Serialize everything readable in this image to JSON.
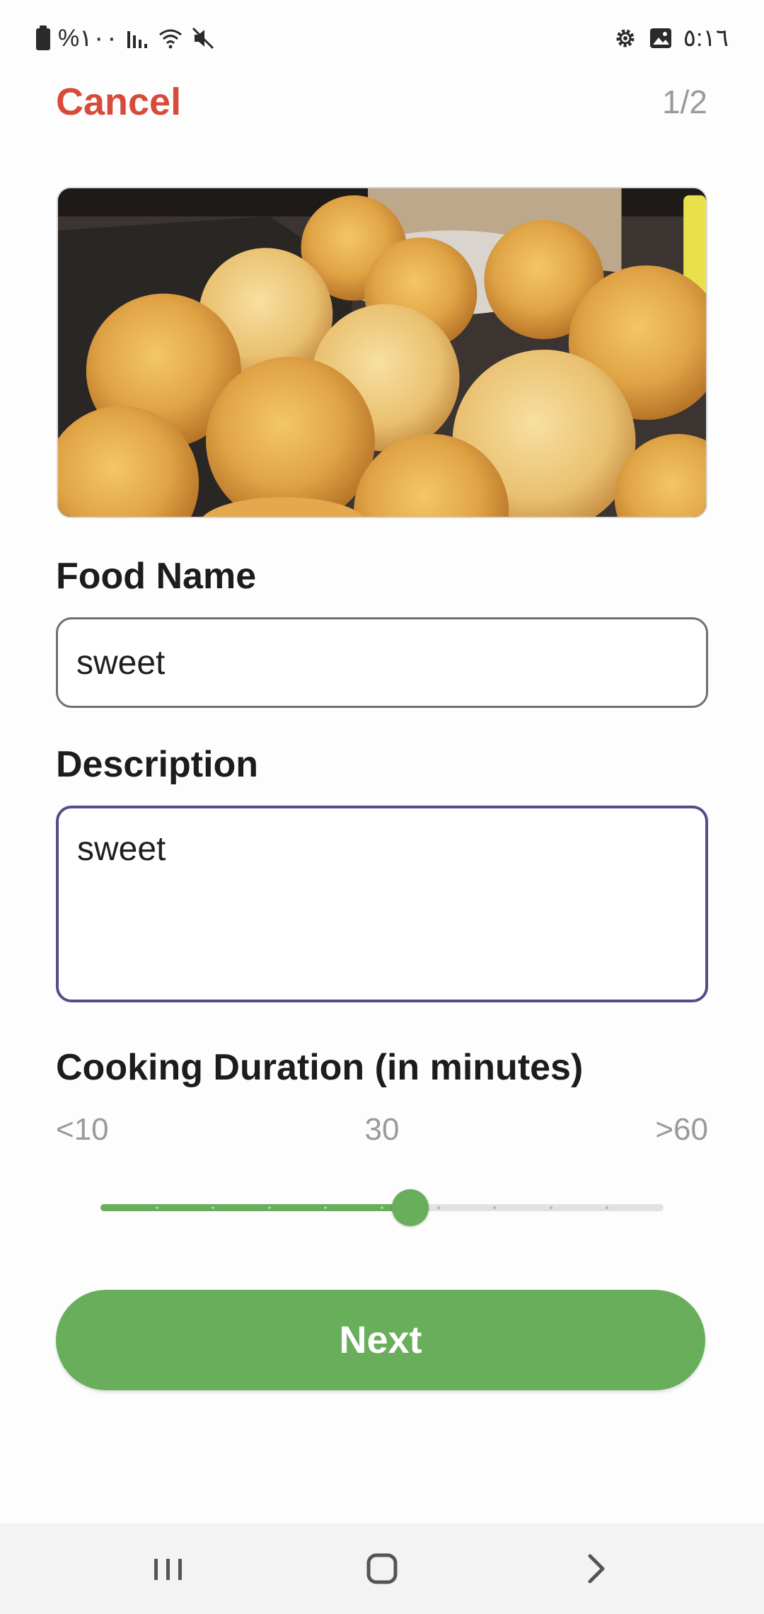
{
  "status_bar": {
    "battery_text": "%١٠٠",
    "time": "٥:١٦",
    "icons": [
      "battery-icon",
      "signal-icon",
      "wifi-icon",
      "mute-icon",
      "settings-icon",
      "gallery-icon"
    ]
  },
  "header": {
    "cancel_label": "Cancel",
    "step": "1/2"
  },
  "form": {
    "image_alt": "food photo: baked bread rolls",
    "food_name_label": "Food Name",
    "food_name_value": "sweet",
    "description_label": "Description",
    "description_value": "sweet",
    "duration_label": "Cooking Duration (in minutes)",
    "slider": {
      "min_label": "<10",
      "mid_label": "30",
      "max_label": ">60",
      "steps": 11,
      "value_step": 6,
      "value_fraction": 0.55
    },
    "next_label": "Next"
  },
  "nav_bar": {
    "icons": [
      "recents-icon",
      "home-icon",
      "back-icon"
    ]
  },
  "colors": {
    "accent_green": "#69ae5b",
    "cancel_red": "#d84a3a",
    "focus_purple": "#5b4a8a"
  }
}
